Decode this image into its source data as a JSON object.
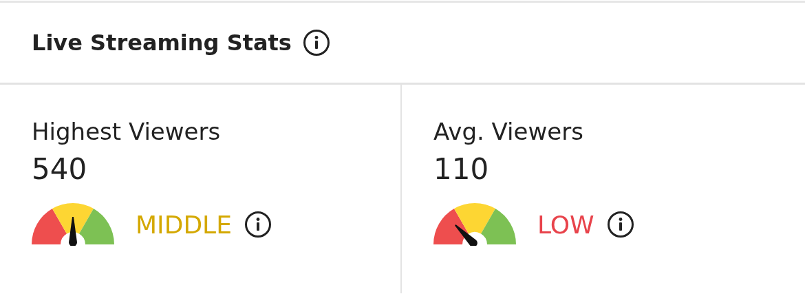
{
  "card": {
    "title": "Live Streaming Stats"
  },
  "stats": [
    {
      "label": "Highest Viewers",
      "value": "540",
      "kind": "middle",
      "rating": "MIDDLE",
      "color": "#d4a800"
    },
    {
      "label": "Avg. Viewers",
      "value": "110",
      "kind": "low",
      "rating": "LOW",
      "color": "#e8434b"
    }
  ]
}
